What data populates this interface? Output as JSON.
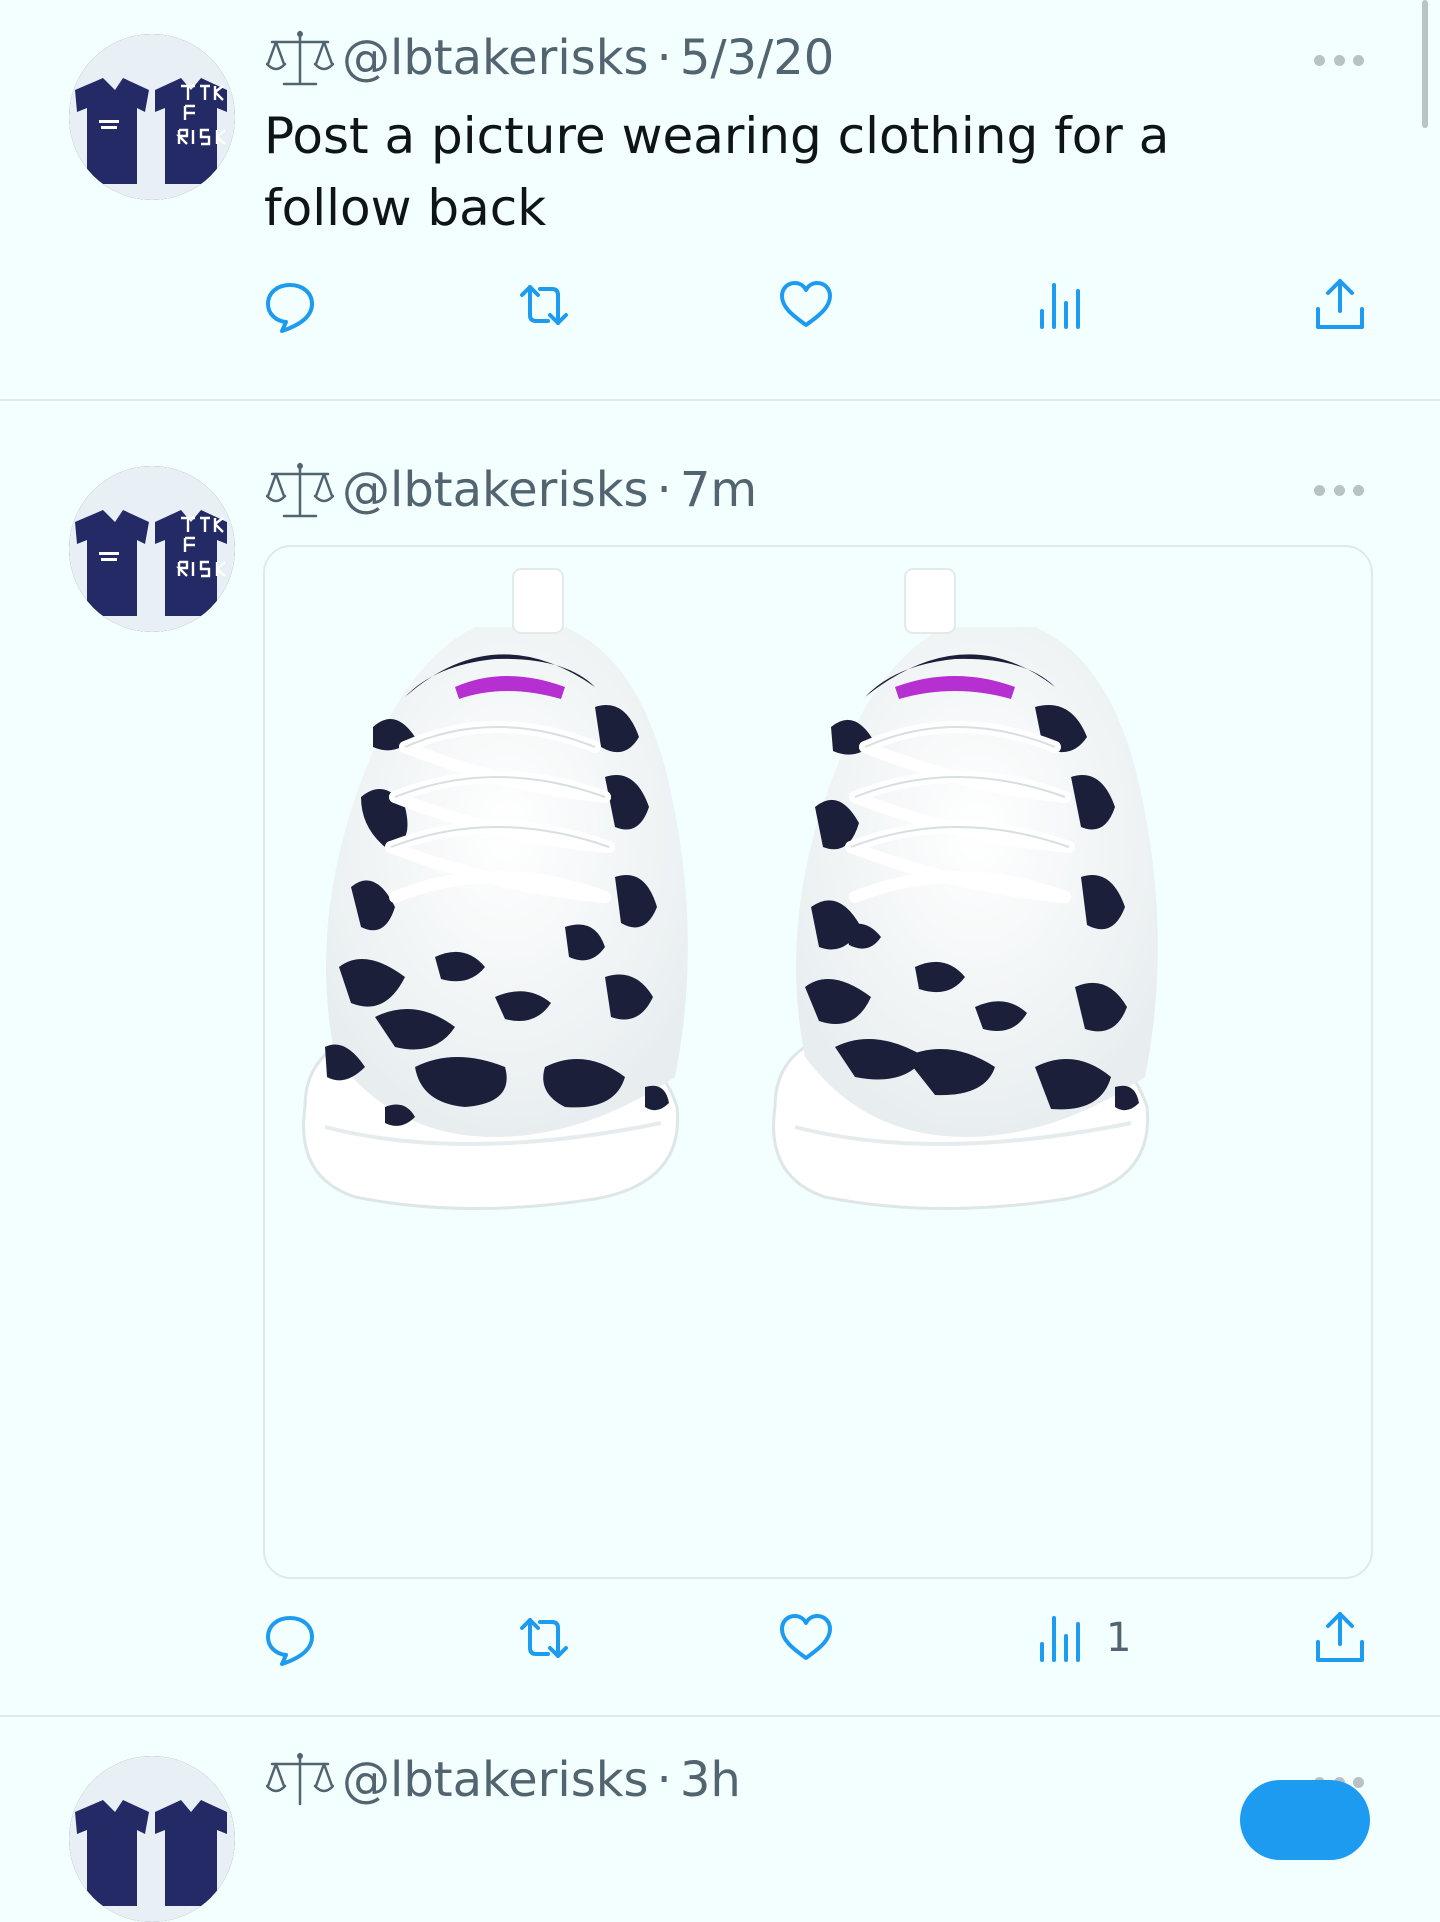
{
  "colors": {
    "background": "#f3ffff",
    "icon": "#1d9bf0",
    "muted": "#536471",
    "text": "#0f1419"
  },
  "tweets": [
    {
      "avatar_icon": "take-risks-tshirts-avatar",
      "badge_icon": "scales-icon",
      "handle": "@lbtakerisks",
      "separator": "·",
      "time": "5/3/20",
      "text": "Post a picture wearing clothing for a follow back",
      "views": ""
    },
    {
      "avatar_icon": "take-risks-tshirts-avatar",
      "badge_icon": "scales-icon",
      "handle": "@lbtakerisks",
      "separator": "·",
      "time": "7m",
      "media": "black-and-white-cow-print-sneakers",
      "views": "1"
    },
    {
      "avatar_icon": "take-risks-tshirts-avatar",
      "badge_icon": "scales-icon",
      "handle": "@lbtakerisks",
      "separator": "·",
      "time": "3h"
    }
  ],
  "action_icons": [
    "reply-icon",
    "retweet-icon",
    "like-icon",
    "views-icon",
    "share-icon"
  ]
}
